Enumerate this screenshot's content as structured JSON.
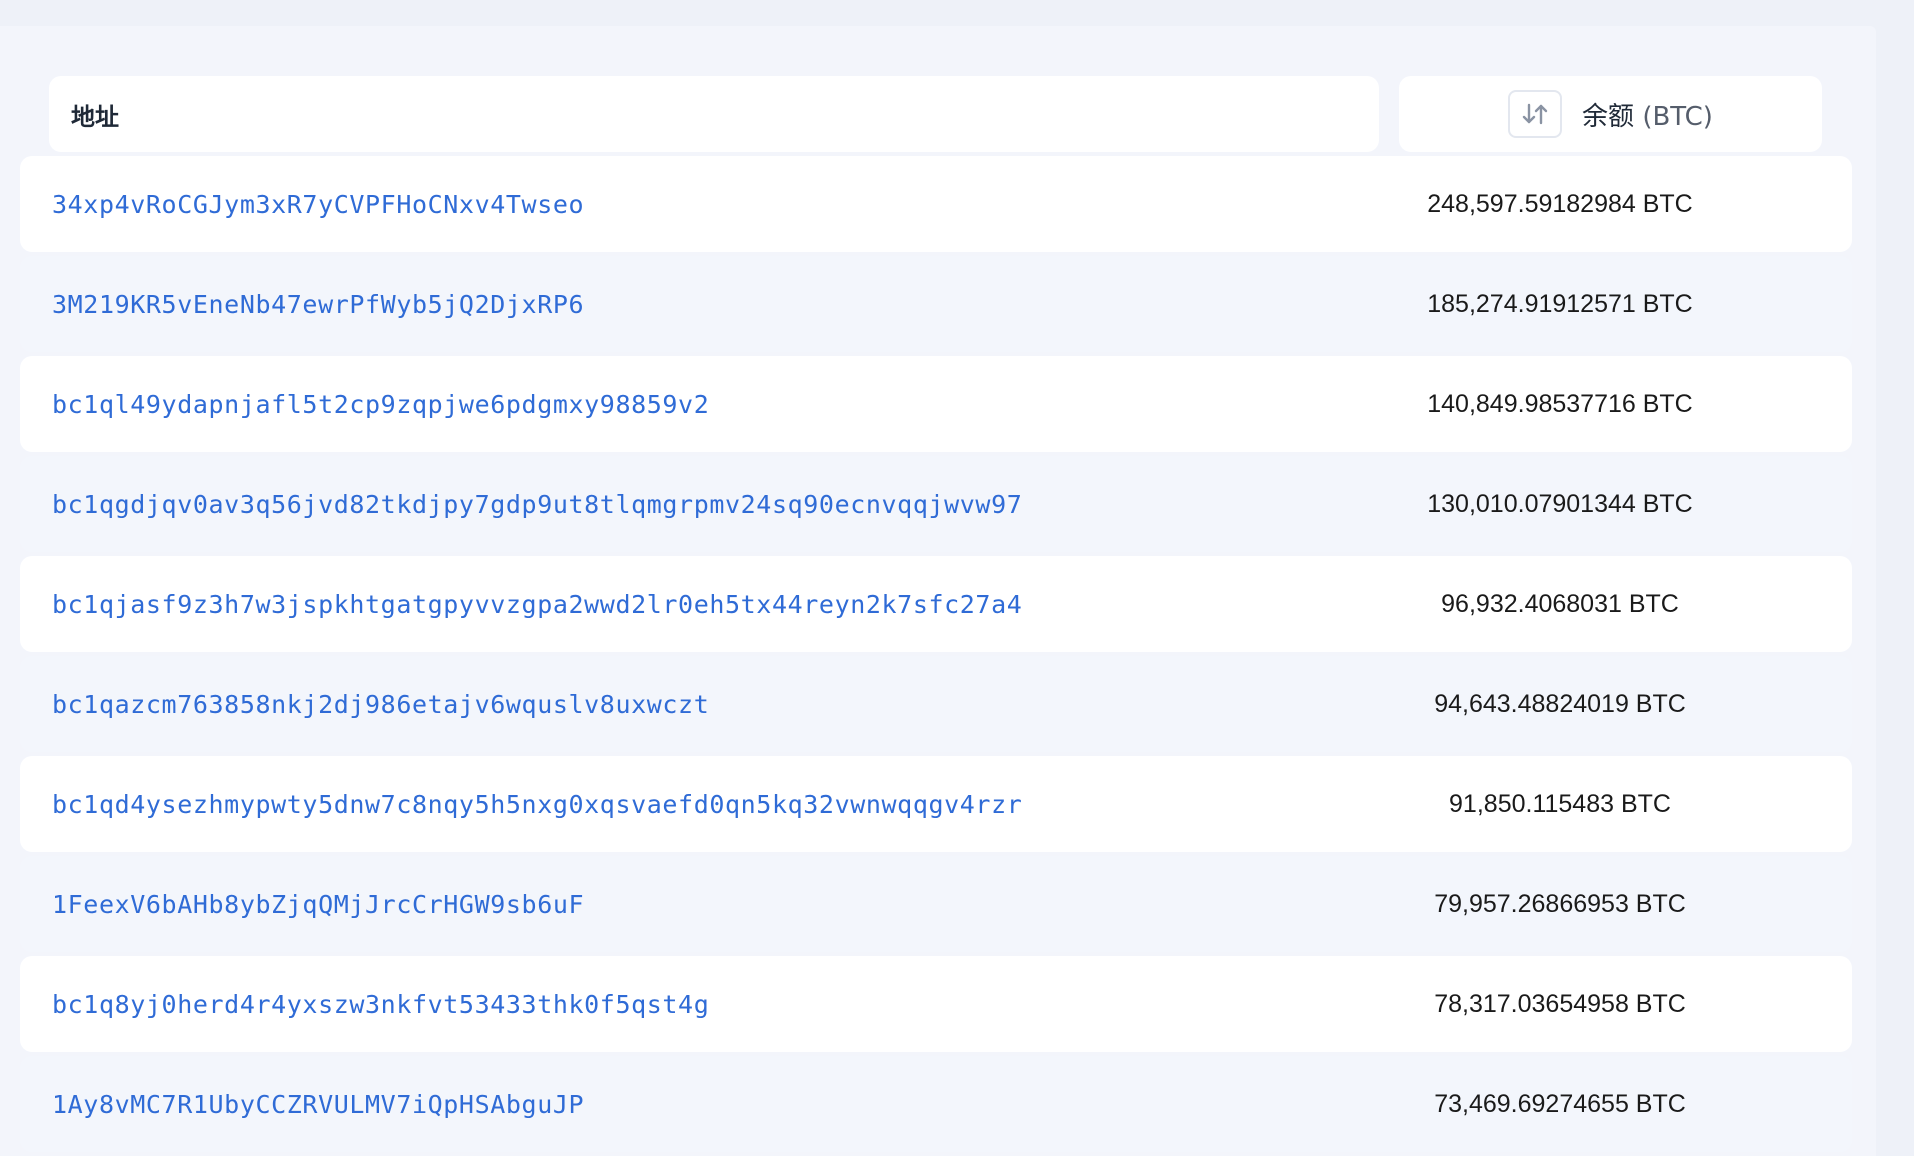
{
  "table": {
    "header": {
      "address_label": "地址",
      "balance_label": "余额",
      "balance_unit": "(BTC)",
      "sort_icon": "sort-arrows-icon"
    },
    "rows": [
      {
        "address": "34xp4vRoCGJym3xR7yCVPFHoCNxv4Twseo",
        "balance": "248,597.59182984 BTC"
      },
      {
        "address": "3M219KR5vEneNb47ewrPfWyb5jQ2DjxRP6",
        "balance": "185,274.91912571 BTC"
      },
      {
        "address": "bc1ql49ydapnjafl5t2cp9zqpjwe6pdgmxy98859v2",
        "balance": "140,849.98537716 BTC"
      },
      {
        "address": "bc1qgdjqv0av3q56jvd82tkdjpy7gdp9ut8tlqmgrpmv24sq90ecnvqqjwvw97",
        "balance": "130,010.07901344 BTC"
      },
      {
        "address": "bc1qjasf9z3h7w3jspkhtgatgpyvvzgpa2wwd2lr0eh5tx44reyn2k7sfc27a4",
        "balance": "96,932.4068031 BTC"
      },
      {
        "address": "bc1qazcm763858nkj2dj986etajv6wquslv8uxwczt",
        "balance": "94,643.48824019 BTC"
      },
      {
        "address": "bc1qd4ysezhmypwty5dnw7c8nqy5h5nxg0xqsvaefd0qn5kq32vwnwqqgv4rzr",
        "balance": "91,850.115483 BTC"
      },
      {
        "address": "1FeexV6bAHb8ybZjqQMjJrcCrHGW9sb6uF",
        "balance": "79,957.26866953 BTC"
      },
      {
        "address": "bc1q8yj0herd4r4yxszw3nkfvt53433thk0f5qst4g",
        "balance": "78,317.03654958 BTC"
      },
      {
        "address": "1Ay8vMC7R1UbyCCZRVULMV7iQpHSAbguJP",
        "balance": "73,469.69274655 BTC"
      }
    ]
  }
}
